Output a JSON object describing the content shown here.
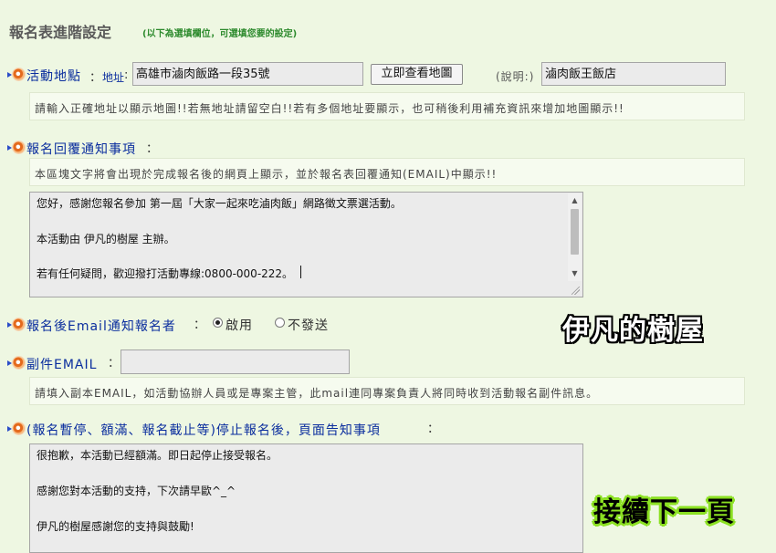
{
  "header": {
    "title": "報名表進階設定",
    "subtitle": "(以下為選填欄位，可選填您要的設定)"
  },
  "location": {
    "label": "活動地點",
    "address_label": "地址",
    "address_value": "高雄市滷肉飯路一段35號",
    "map_button": "立即查看地圖",
    "note_label": "(說明:)",
    "note_value": "滷肉飯王飯店",
    "hint": "請輸入正確地址以顯示地圖!!若無地址請留空白!!若有多個地址要顯示，也可稍後利用補充資訊來增加地圖顯示!!"
  },
  "reply_notice": {
    "label": "報名回覆通知事項",
    "hint": "本區塊文字將會出現於完成報名後的網頁上顯示，並於報名表回覆通知(EMAIL)中顯示!!",
    "lines": [
      "您好，感謝您報名參加 第一屆「大家一起來吃滷肉飯」網路徵文票選活動。",
      "本活動由 伊凡的樹屋 主辦。",
      "若有任何疑問，歡迎撥打活動專線:0800-000-222。"
    ]
  },
  "email_notify": {
    "label": "報名後Email通知報名者",
    "option_on": "啟用",
    "option_off": "不發送",
    "selected": "啟用"
  },
  "cc_email": {
    "label": "副件EMAIL",
    "value": "",
    "hint": "請填入副本EMAIL，如活動協辦人員或是專案主管，此mail連同專案負責人將同時收到活動報名副件訊息。"
  },
  "stop_notice": {
    "label": "(報名暫停、額滿、報名截止等)停止報名後，頁面告知事項",
    "lines": [
      "很抱歉，本活動已經額滿。即日起停止接受報名。",
      "感謝您對本活動的支持，下次請早歐^_^",
      "伊凡的樹屋感謝您的支持與鼓勵!"
    ]
  },
  "watermarks": {
    "top": "伊凡的樹屋",
    "bottom": "接續下一頁"
  },
  "colors": {
    "background": "#eef7e2",
    "label": "#0b2e9e",
    "subtitle": "#2e8b2e",
    "bullet": "#e46a1d"
  }
}
